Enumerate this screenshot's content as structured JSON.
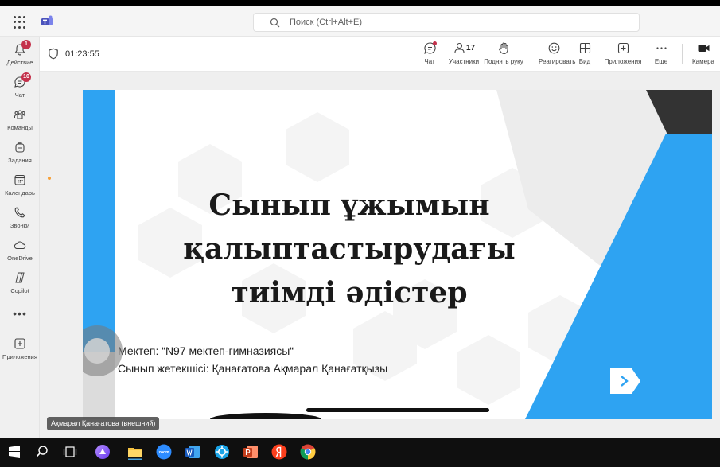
{
  "titlebar": {
    "search_placeholder": "Поиск (Ctrl+Alt+E)"
  },
  "rail": {
    "items": [
      {
        "label": "Действие",
        "badge": "1"
      },
      {
        "label": "Чат",
        "badge": "10"
      },
      {
        "label": "Команды"
      },
      {
        "label": "Задания"
      },
      {
        "label": "Календарь"
      },
      {
        "label": "Звонки"
      },
      {
        "label": "OneDrive"
      },
      {
        "label": "Copilot"
      },
      {
        "label": "Приложения"
      }
    ],
    "more": "•••"
  },
  "meeting": {
    "timer": "01:23:55",
    "tools": {
      "chat": "Чат",
      "participants": "Участники",
      "participants_count": "17",
      "raise_hand": "Поднять руку",
      "react": "Реагировать",
      "view": "Вид",
      "apps": "Приложения",
      "more": "Еще",
      "camera": "Камера"
    }
  },
  "slide": {
    "title_lines": [
      "Сынып ұжымын",
      "қалыптастырудағы",
      "тиімді әдістер"
    ],
    "school": "Мектеп: “N97 мектеп-гимназиясы“",
    "teacher": "Сынып жетекшісі: Қанағатова Ақмарал Қанағатқызы"
  },
  "presenter": {
    "name_tag": "Ақмарал Қанағатова (внешний)"
  },
  "colors": {
    "accent_blue": "#2ea3f2",
    "teams_purple": "#5b5fc7",
    "badge_red": "#c4314b"
  },
  "taskbar": {
    "icons": [
      "windows-start-icon",
      "search-icon",
      "task-view-icon",
      "alice-icon",
      "file-explorer-icon",
      "zoom-icon",
      "word-icon",
      "settings-app-icon",
      "powerpoint-icon",
      "yandex-browser-icon",
      "chrome-icon"
    ],
    "zoom_label": "zoom"
  }
}
